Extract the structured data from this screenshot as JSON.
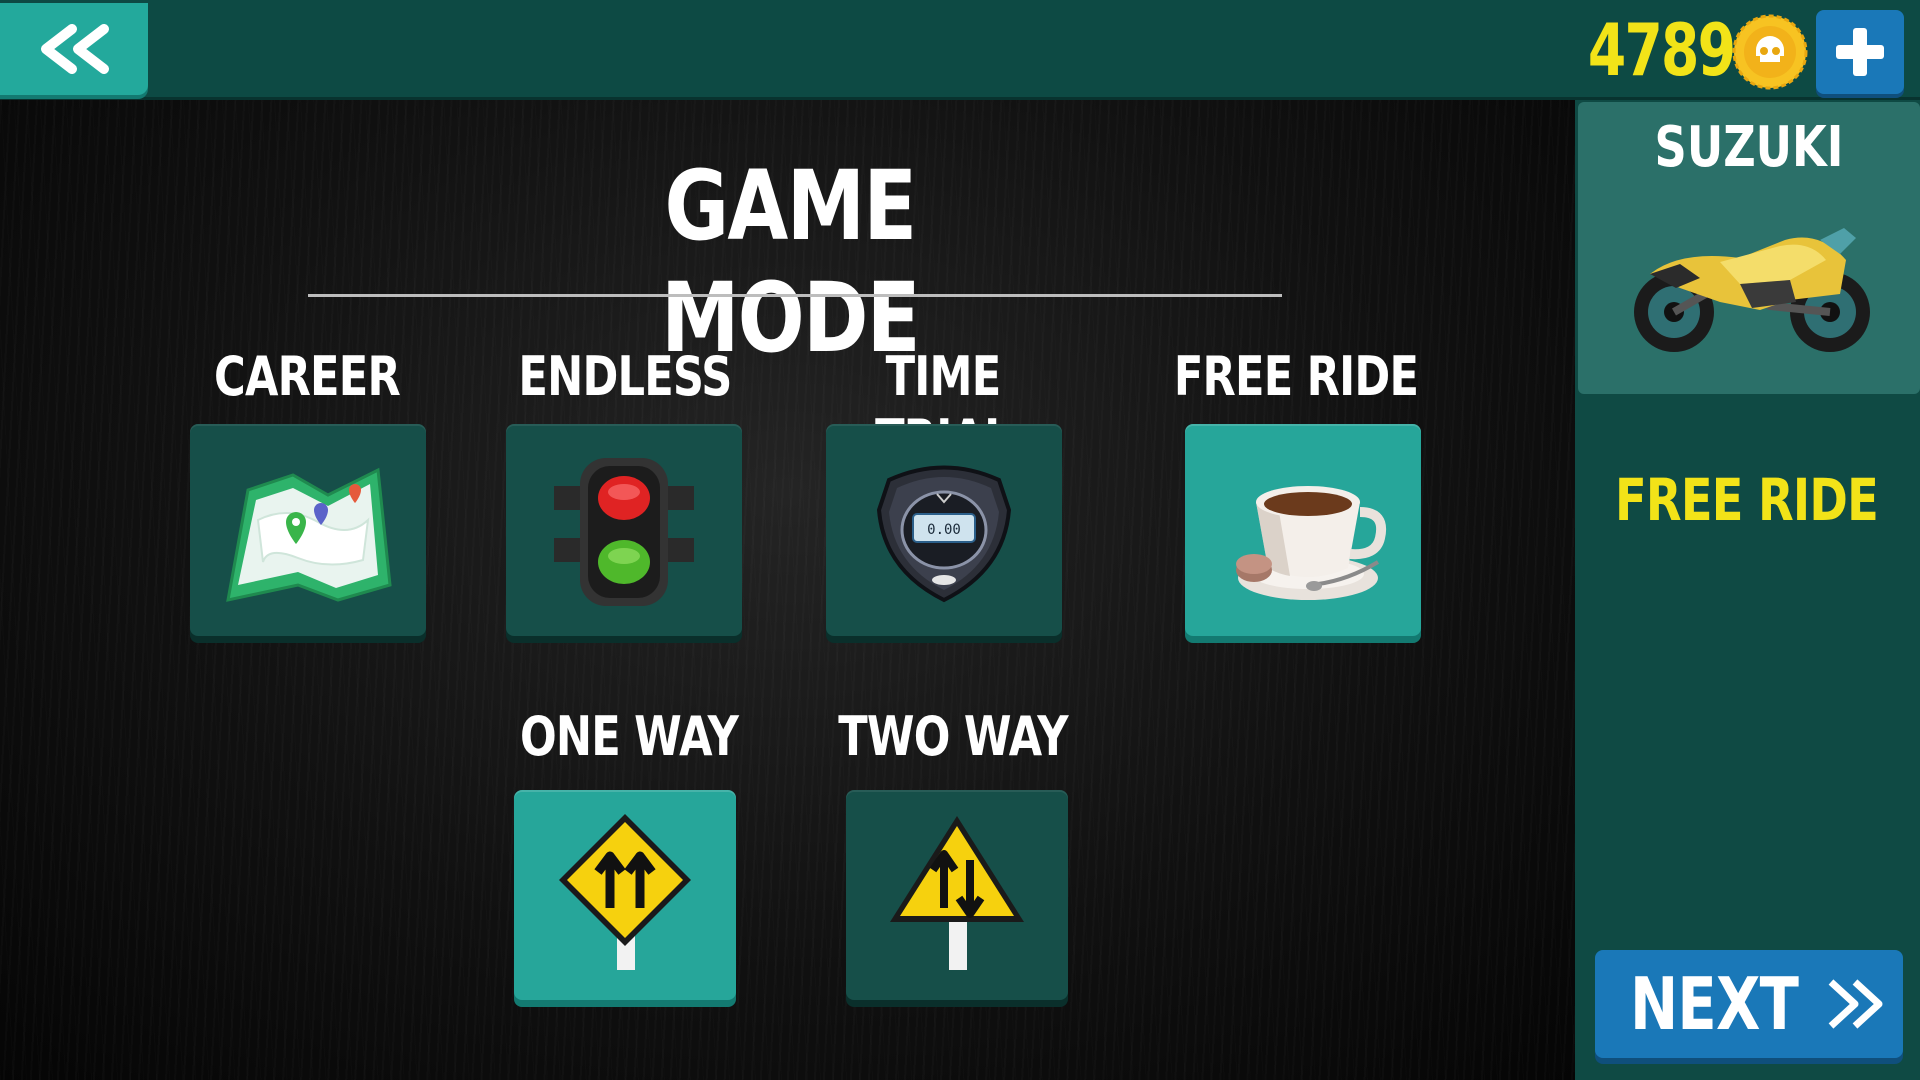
{
  "header": {
    "coin_balance": "4789"
  },
  "page": {
    "title": "GAME MODE"
  },
  "modes": [
    {
      "label": "CAREER",
      "icon": "map-icon",
      "selected": false
    },
    {
      "label": "ENDLESS",
      "icon": "traffic-light-icon",
      "selected": false
    },
    {
      "label": "TIME TRIAL",
      "icon": "stopwatch-icon",
      "selected": false
    },
    {
      "label": "FREE RIDE",
      "icon": "coffee-cup-icon",
      "selected": true
    },
    {
      "label": "ONE WAY",
      "icon": "one-way-sign-icon",
      "selected": true
    },
    {
      "label": "TWO WAY",
      "icon": "two-way-sign-icon",
      "selected": false
    }
  ],
  "sidebar": {
    "bike_name": "SUZUKI",
    "selected_mode_label": "FREE RIDE",
    "next_label": "NEXT"
  },
  "colors": {
    "accent_teal": "#26a69a",
    "tile_dark": "#164f49",
    "header_bg": "#0d4a44",
    "coin_yellow": "#f2e318",
    "button_blue": "#1a78b8"
  }
}
